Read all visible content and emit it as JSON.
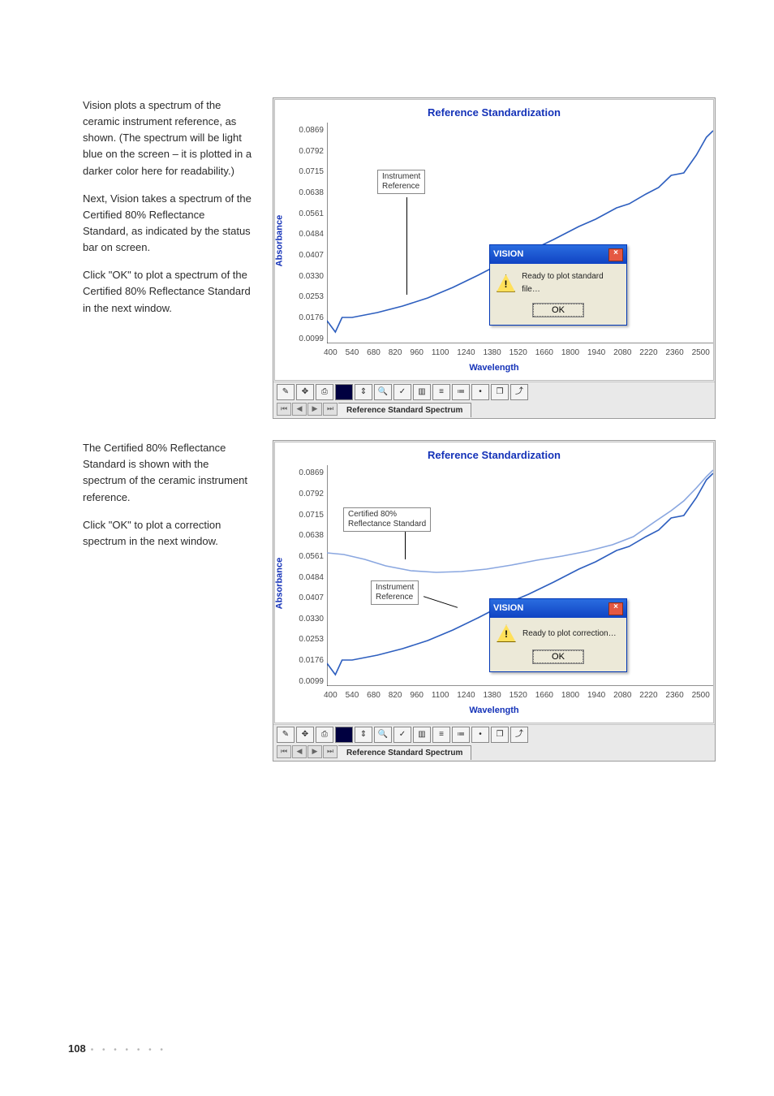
{
  "paragraphs": {
    "p1": "Vision plots a spectrum of the ceramic instrument reference, as shown. (The spectrum will be light blue on the screen – it is plotted in a darker color here for readability.)",
    "p2": "Next, Vision takes a spectrum of the Certified 80% Reflectance Standard, as indicated by the status bar on screen.",
    "p3": "Click \"OK\" to plot a spectrum of the Certified 80% Reflectance Standard in the next window.",
    "p4": "The Certified 80% Reflectance Standard is shown with the spectrum of the ceramic instrument reference.",
    "p5": "Click \"OK\" to plot a correction spectrum in the next window."
  },
  "chart1": {
    "title": "Reference Standardization",
    "ylabel": "Absorbance",
    "xlabel": "Wavelength",
    "annot_ref": "Instrument\nReference",
    "dlg_title": "VISION",
    "dlg_msg": "Ready to plot standard file…",
    "dlg_ok": "OK",
    "tab": "Reference Standard Spectrum"
  },
  "chart2": {
    "title": "Reference Standardization",
    "ylabel": "Absorbance",
    "xlabel": "Wavelength",
    "annot_ref": "Instrument\nReference",
    "annot_cert": "Certified 80%\nReflectance Standard",
    "dlg_title": "VISION",
    "dlg_msg": "Ready to plot correction…",
    "dlg_ok": "OK",
    "tab": "Reference Standard Spectrum"
  },
  "yticks": [
    "0.0869",
    "0.0792",
    "0.0715",
    "0.0638",
    "0.0561",
    "0.0484",
    "0.0407",
    "0.0330",
    "0.0253",
    "0.0176",
    "0.0099"
  ],
  "xticks": [
    "400",
    "540",
    "680",
    "820",
    "960",
    "1100",
    "1240",
    "1380",
    "1520",
    "1660",
    "1800",
    "1940",
    "2080",
    "2220",
    "2360",
    "2500"
  ],
  "chart_data": [
    {
      "type": "line",
      "title": "Reference Standardization",
      "xlabel": "Wavelength",
      "ylabel": "Absorbance",
      "xlim": [
        400,
        2500
      ],
      "ylim": [
        0.0099,
        0.0869
      ],
      "series": [
        {
          "name": "Instrument Reference",
          "x": [
            400,
            540,
            680,
            820,
            960,
            1100,
            1240,
            1380,
            1520,
            1660,
            1800,
            1940,
            2080,
            2220,
            2360,
            2500
          ],
          "values": [
            0.018,
            0.019,
            0.022,
            0.026,
            0.031,
            0.036,
            0.042,
            0.046,
            0.05,
            0.055,
            0.06,
            0.064,
            0.07,
            0.075,
            0.082,
            0.086
          ]
        }
      ]
    },
    {
      "type": "line",
      "title": "Reference Standardization",
      "xlabel": "Wavelength",
      "ylabel": "Absorbance",
      "xlim": [
        400,
        2500
      ],
      "ylim": [
        0.0099,
        0.0869
      ],
      "series": [
        {
          "name": "Instrument Reference",
          "x": [
            400,
            540,
            680,
            820,
            960,
            1100,
            1240,
            1380,
            1520,
            1660,
            1800,
            1940,
            2080,
            2220,
            2360,
            2500
          ],
          "values": [
            0.018,
            0.019,
            0.022,
            0.026,
            0.031,
            0.036,
            0.042,
            0.046,
            0.05,
            0.055,
            0.06,
            0.064,
            0.07,
            0.075,
            0.082,
            0.086
          ]
        },
        {
          "name": "Certified 80% Reflectance Standard",
          "x": [
            400,
            540,
            680,
            820,
            960,
            1100,
            1240,
            1380,
            1520,
            1660,
            1800,
            1940,
            2080,
            2220,
            2360,
            2500
          ],
          "values": [
            0.057,
            0.056,
            0.054,
            0.05,
            0.049,
            0.049,
            0.051,
            0.053,
            0.055,
            0.058,
            0.06,
            0.062,
            0.066,
            0.072,
            0.08,
            0.087
          ]
        }
      ]
    }
  ],
  "footer": {
    "page": "108"
  }
}
